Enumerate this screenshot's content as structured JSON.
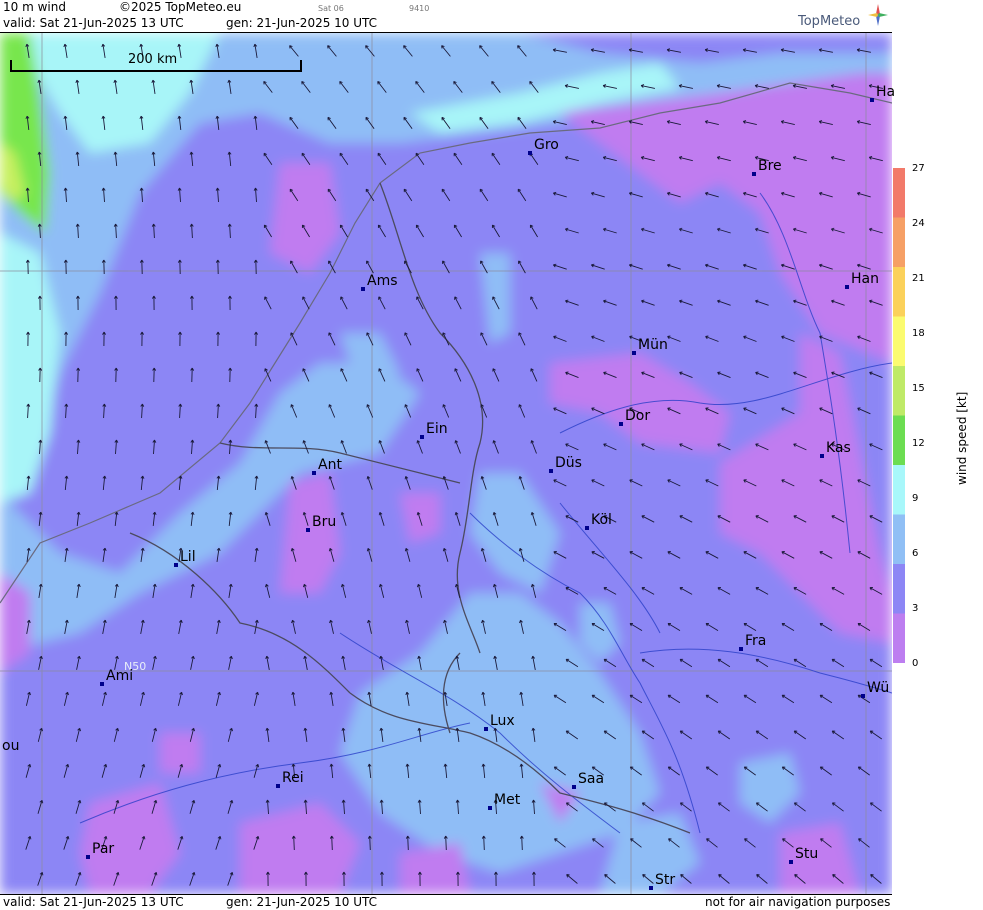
{
  "header": {
    "product": "10 m wind",
    "copyright": "©2025 TopMeteo.eu",
    "satellite": "Sat 06",
    "code": "9410",
    "valid": "valid:  Sat  21-Jun-2025  13 UTC",
    "generated": "gen:  21-Jun-2025 10 UTC",
    "logo": "TopMeteo"
  },
  "footer": {
    "valid": "valid:  Sat  21-Jun-2025  13 UTC",
    "generated": "gen:  21-Jun-2025 10 UTC",
    "disclaimer": "not for air navigation purposes"
  },
  "scale_bar": {
    "label": "200 km"
  },
  "grid_label": "N50",
  "cities": [
    {
      "name": "Gro"
    },
    {
      "name": "Bre"
    },
    {
      "name": "Ha"
    },
    {
      "name": "Ams"
    },
    {
      "name": "Han"
    },
    {
      "name": "Mün"
    },
    {
      "name": "Dor"
    },
    {
      "name": "Ein"
    },
    {
      "name": "Kas"
    },
    {
      "name": "Düs"
    },
    {
      "name": "Ant"
    },
    {
      "name": "Köl"
    },
    {
      "name": "Bru"
    },
    {
      "name": "Lil"
    },
    {
      "name": "Fra"
    },
    {
      "name": "Ami"
    },
    {
      "name": "Wü"
    },
    {
      "name": "Lux"
    },
    {
      "name": "Rei"
    },
    {
      "name": "Saa"
    },
    {
      "name": "Met"
    },
    {
      "name": "ou"
    },
    {
      "name": "Par"
    },
    {
      "name": "Stu"
    },
    {
      "name": "Str"
    }
  ],
  "colorbar": {
    "title": "wind  speed  [kt]",
    "ticks": [
      "27",
      "24",
      "21",
      "18",
      "15",
      "12",
      "9",
      "6",
      "3",
      "0"
    ],
    "colors": [
      "#f27a6a",
      "#f6a066",
      "#fbd15b",
      "#fbfb70",
      "#bfea68",
      "#6cdd52",
      "#a8f7fa",
      "#90bff5",
      "#8d86f5",
      "#bd7ef0"
    ]
  },
  "colors": {
    "calm": "#c07cf0",
    "light": "#8c86f5",
    "moderate": "#8fbdf6",
    "fresh": "#a8f5f8",
    "strong": "#78e64e",
    "very_strong": "#c8f060"
  }
}
